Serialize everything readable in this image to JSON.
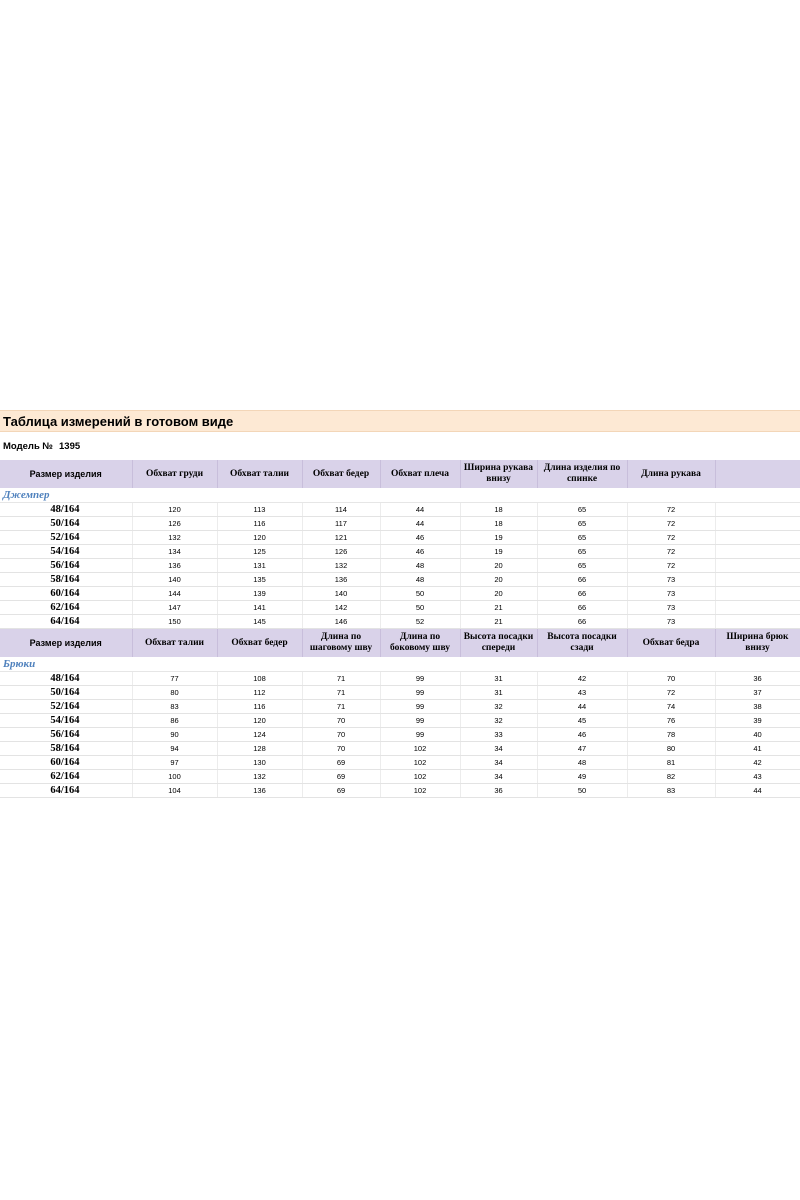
{
  "title": "Таблица измерений в готовом виде",
  "model_label": "Модель №",
  "model_number": "1395",
  "jumper": {
    "section_label": "Джемпер",
    "headers": [
      "Размер изделия",
      "Обхват груди",
      "Обхват талии",
      "Обхват бедер",
      "Обхват плеча",
      "Ширина рукава внизу",
      "Длина изделия по спинке",
      "Длина рукава",
      ""
    ],
    "rows": [
      [
        "48/164",
        "120",
        "113",
        "114",
        "44",
        "18",
        "65",
        "72",
        ""
      ],
      [
        "50/164",
        "126",
        "116",
        "117",
        "44",
        "18",
        "65",
        "72",
        ""
      ],
      [
        "52/164",
        "132",
        "120",
        "121",
        "46",
        "19",
        "65",
        "72",
        ""
      ],
      [
        "54/164",
        "134",
        "125",
        "126",
        "46",
        "19",
        "65",
        "72",
        ""
      ],
      [
        "56/164",
        "136",
        "131",
        "132",
        "48",
        "20",
        "65",
        "72",
        ""
      ],
      [
        "58/164",
        "140",
        "135",
        "136",
        "48",
        "20",
        "66",
        "73",
        ""
      ],
      [
        "60/164",
        "144",
        "139",
        "140",
        "50",
        "20",
        "66",
        "73",
        ""
      ],
      [
        "62/164",
        "147",
        "141",
        "142",
        "50",
        "21",
        "66",
        "73",
        ""
      ],
      [
        "64/164",
        "150",
        "145",
        "146",
        "52",
        "21",
        "66",
        "73",
        ""
      ]
    ]
  },
  "pants": {
    "section_label": "Брюки",
    "headers": [
      "Размер изделия",
      "Обхват талии",
      "Обхват бедер",
      "Длина по шаговому шву",
      "Длина по боковому шву",
      "Высота посадки спереди",
      "Высота посадки сзади",
      "Обхват бедра",
      "Ширина брюк внизу"
    ],
    "rows": [
      [
        "48/164",
        "77",
        "108",
        "71",
        "99",
        "31",
        "42",
        "70",
        "36"
      ],
      [
        "50/164",
        "80",
        "112",
        "71",
        "99",
        "31",
        "43",
        "72",
        "37"
      ],
      [
        "52/164",
        "83",
        "116",
        "71",
        "99",
        "32",
        "44",
        "74",
        "38"
      ],
      [
        "54/164",
        "86",
        "120",
        "70",
        "99",
        "32",
        "45",
        "76",
        "39"
      ],
      [
        "56/164",
        "90",
        "124",
        "70",
        "99",
        "33",
        "46",
        "78",
        "40"
      ],
      [
        "58/164",
        "94",
        "128",
        "70",
        "102",
        "34",
        "47",
        "80",
        "41"
      ],
      [
        "60/164",
        "97",
        "130",
        "69",
        "102",
        "34",
        "48",
        "81",
        "42"
      ],
      [
        "62/164",
        "100",
        "132",
        "69",
        "102",
        "34",
        "49",
        "82",
        "43"
      ],
      [
        "64/164",
        "104",
        "136",
        "69",
        "102",
        "36",
        "50",
        "83",
        "44"
      ]
    ]
  },
  "colors": {
    "title_bg": "#fde9d4",
    "header_bg": "#d9d2e9",
    "section_label": "#4f81bd"
  }
}
